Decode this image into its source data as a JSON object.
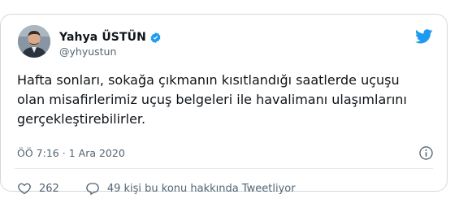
{
  "user": {
    "display_name": "Yahya ÜSTÜN",
    "handle": "@yhyustun",
    "verified": true
  },
  "tweet": {
    "lines": [
      "Hafta sonları, sokağa çıkmanın kısıtlandığı saatlerde uçuşu",
      "olan misafirlerimiz uçuş belgeleri ile havalimanı ulaşımlarını",
      "gerçekleştirebilirler."
    ],
    "time": "ÖÖ 7:16",
    "separator": "·",
    "date": "1 Ara 2020"
  },
  "actions": {
    "likes": "262",
    "reply_text": "49 kişi bu konu hakkında Tweetliyor"
  },
  "colors": {
    "brand": "#1d9bf0",
    "text": "#0f1419",
    "secondary": "#536471",
    "border": "#cfd9de"
  },
  "icons": {
    "verified": "verified-badge-icon",
    "brand": "twitter-bird-icon",
    "info": "info-icon",
    "like": "heart-icon",
    "reply": "speech-bubble-icon"
  }
}
